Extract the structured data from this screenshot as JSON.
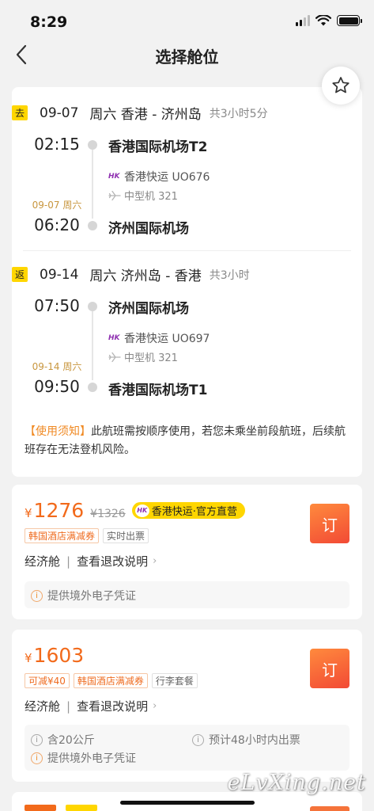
{
  "status_bar": {
    "time": "8:29"
  },
  "nav": {
    "title": "选择舱位"
  },
  "outbound": {
    "tag": "去",
    "date": "09-07",
    "route": "周六 香港 - 济州岛",
    "duration": "共3小时5分",
    "dep_time": "02:15",
    "dep_airport": "香港国际机场T2",
    "airline": "香港快运 UO676",
    "aircraft": "中型机 321",
    "arr_date_note": "09-07 周六",
    "arr_time": "06:20",
    "arr_airport": "济州国际机场"
  },
  "return": {
    "tag": "返",
    "date": "09-14",
    "route": "周六 济州岛 - 香港",
    "duration": "共3小时",
    "dep_time": "07:50",
    "dep_airport": "济州国际机场",
    "airline": "香港快运 UO697",
    "aircraft": "中型机 321",
    "arr_date_note": "09-14 周六",
    "arr_time": "09:50",
    "arr_airport": "香港国际机场T1"
  },
  "notice": {
    "label": "【使用须知】",
    "text": "此航班需按顺序使用，若您未乘坐前段航班，后续航班存在无法登机风险。"
  },
  "offers": [
    {
      "currency": "¥",
      "price": "1276",
      "original_price": "¥1326",
      "brand_badge": "香港快运·官方直营",
      "tags": [
        "韩国酒店满减券",
        "实时出票"
      ],
      "cabin": "经济舱",
      "rules_link": "查看退改说明",
      "info": [
        "提供境外电子凭证"
      ],
      "book_label": "订"
    },
    {
      "currency": "¥",
      "price": "1603",
      "tags": [
        "可减¥40",
        "韩国酒店满减券",
        "行李套餐"
      ],
      "cabin": "经济舱",
      "rules_link": "查看退改说明",
      "info": [
        "含20公斤",
        "预计48小时内出票",
        "提供境外电子凭证"
      ],
      "book_label": "订"
    }
  ],
  "watermark": "eLvXing.net",
  "colors": {
    "accent": "#f26a1b",
    "badge_yellow": "#ffd600",
    "notice_orange": "#f08a24"
  }
}
